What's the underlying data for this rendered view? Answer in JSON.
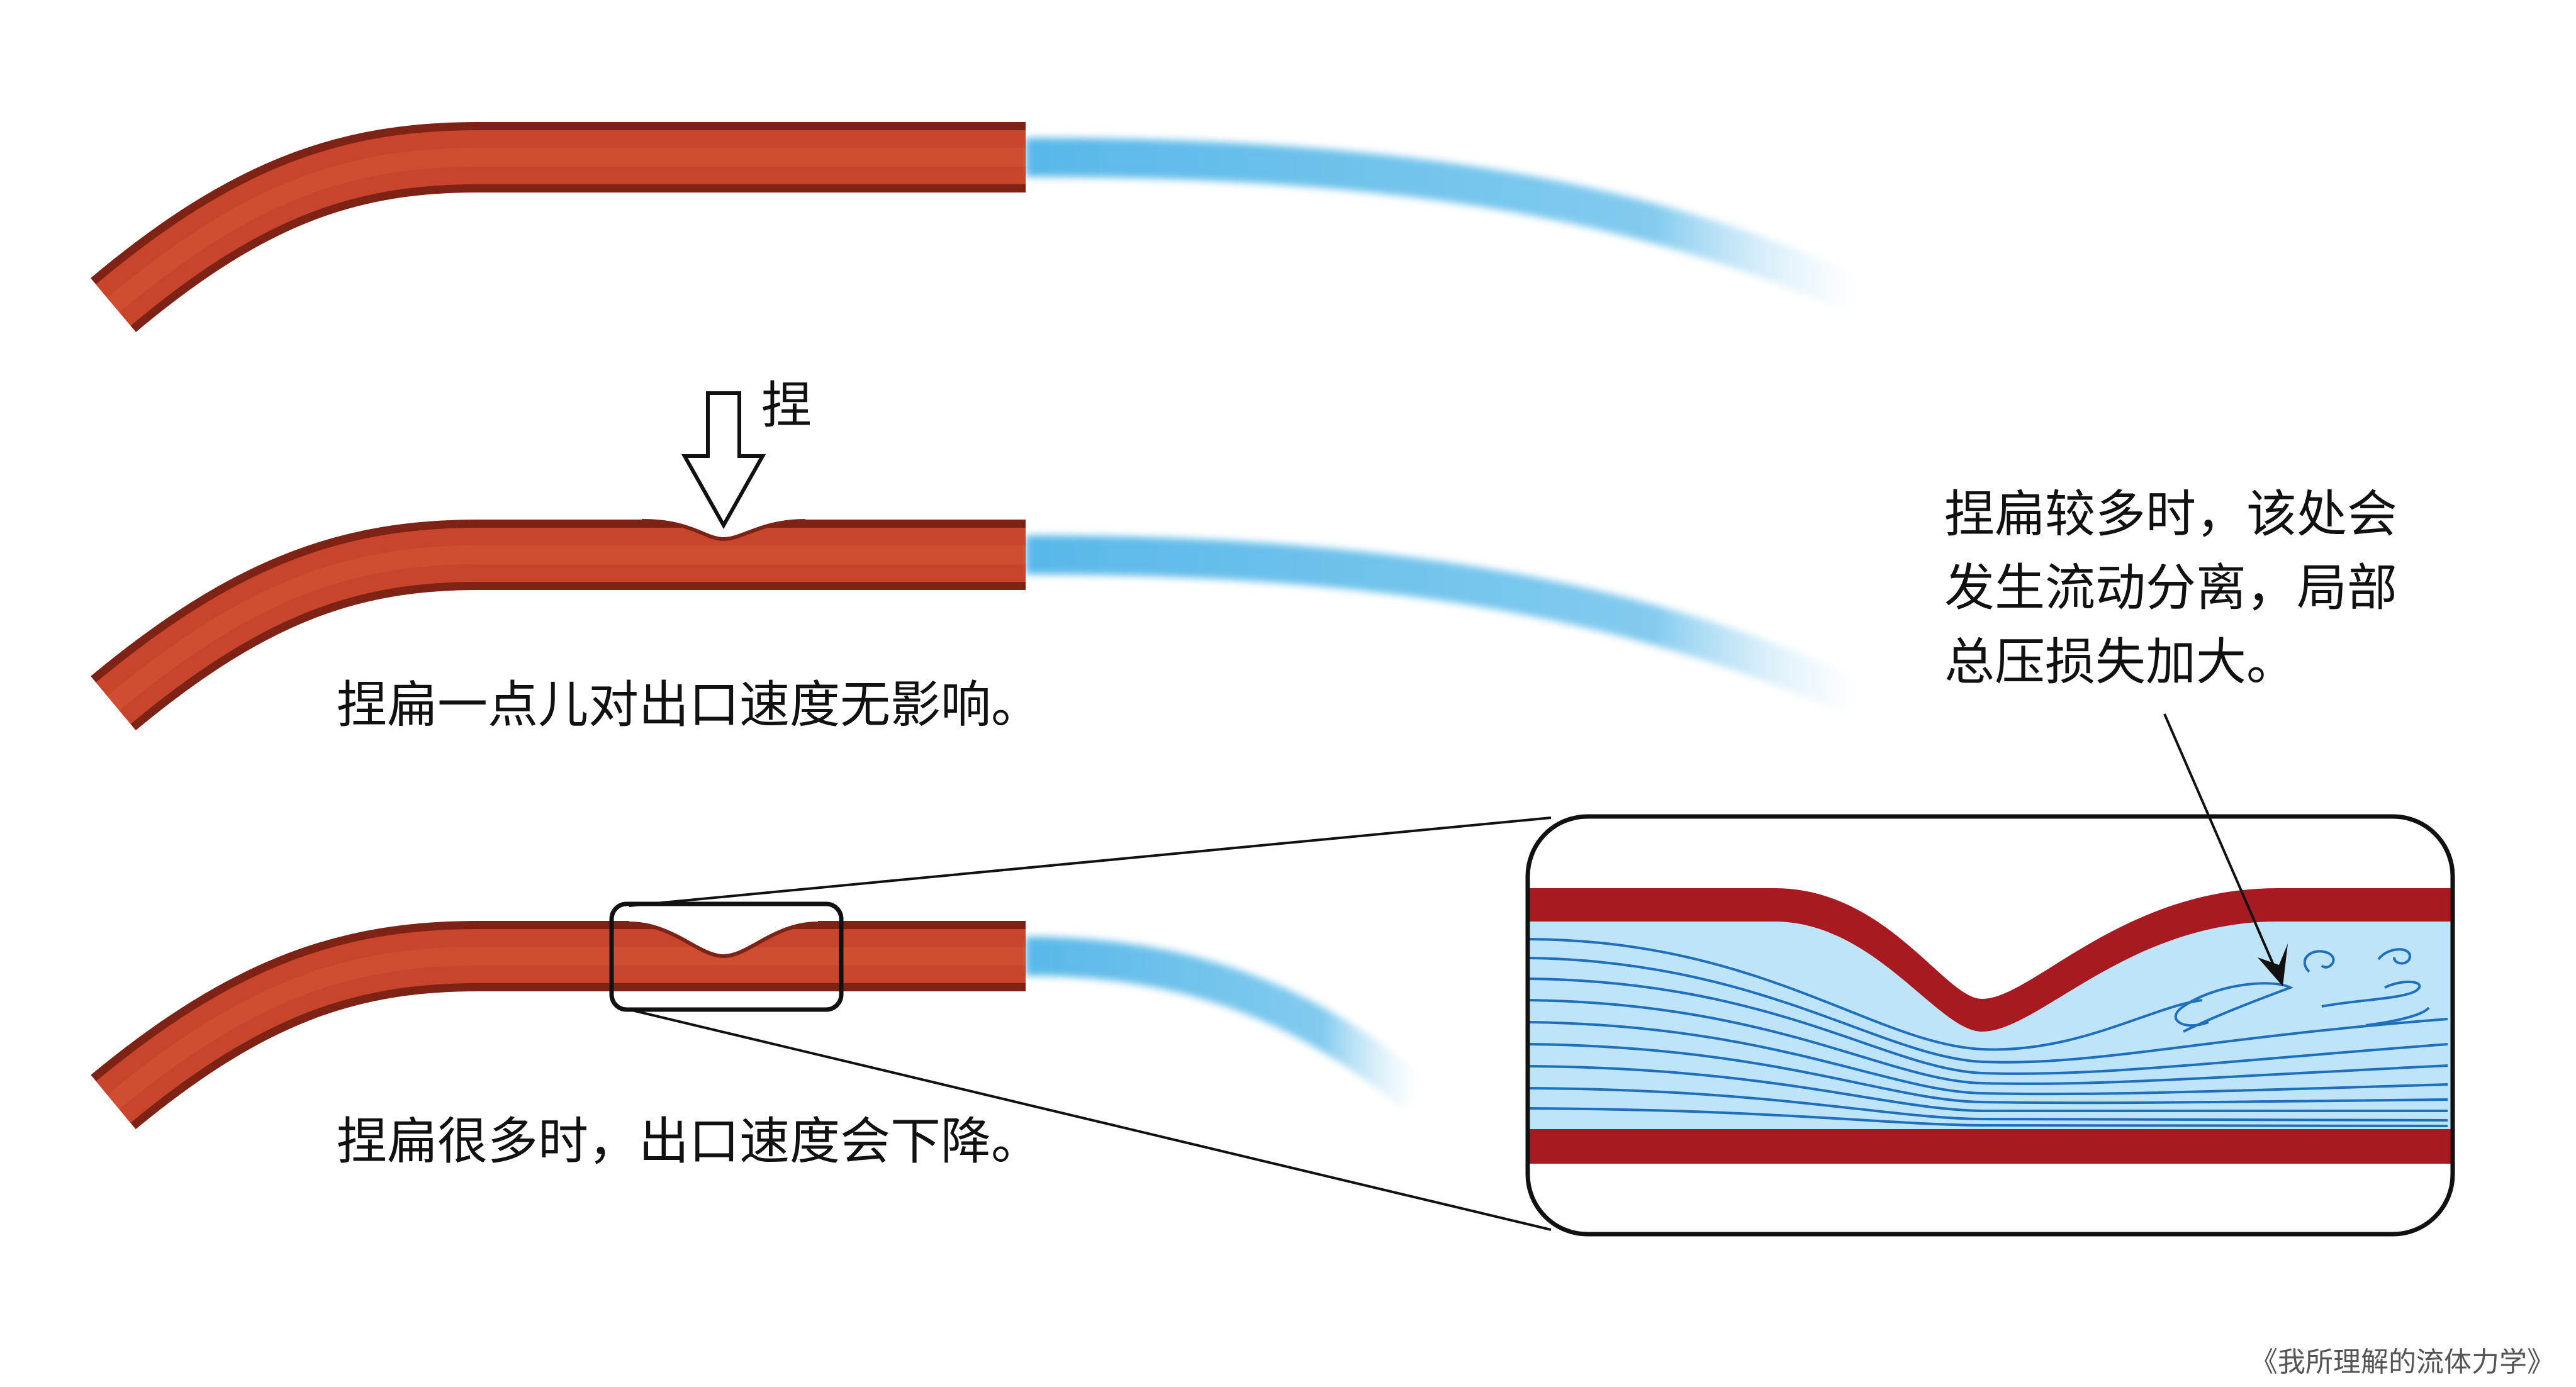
{
  "labels": {
    "squeeze_arrow_label": "捏",
    "slight_squeeze": "捏扁一点儿对出口速度无影响。",
    "heavy_squeeze": "捏扁很多时，出口速度会下降。",
    "detail_note_line1": "捏扁较多时，该处会",
    "detail_note_line2": "发生流动分离，局部",
    "detail_note_line3": "总压损失加大。",
    "credit": "《我所理解的流体力学》"
  },
  "colors": {
    "pipe": "#c0412a",
    "pipe_edge": "#8a2417",
    "pipe_wall_detail": "#a81a22",
    "water": "#6cc0ea",
    "fluid_fill": "#bfe3f7",
    "streamline": "#1f6fbf",
    "outline": "#111111"
  },
  "icons": {
    "squeeze_arrow": "down-arrow-outline-icon"
  }
}
